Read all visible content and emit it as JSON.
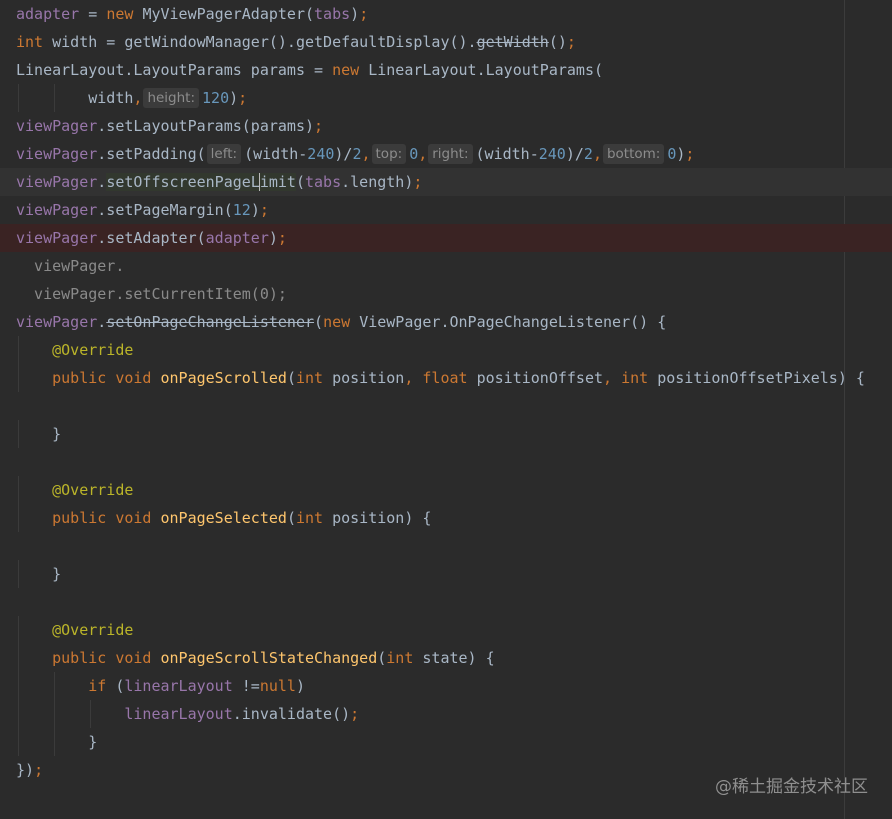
{
  "editor": {
    "language": "java",
    "lines": [
      [
        [
          "var",
          "adapter"
        ],
        [
          "txt",
          " = "
        ],
        [
          "kw",
          "new "
        ],
        [
          "txt",
          "MyViewPagerAdapter("
        ],
        [
          "var",
          "tabs"
        ],
        [
          "txt",
          ")"
        ],
        [
          "kw",
          ";"
        ]
      ],
      [
        [
          "kw",
          "int "
        ],
        [
          "txt",
          "width = getWindowManager().getDefaultDisplay()."
        ],
        [
          "strike",
          "getWidth"
        ],
        [
          "txt",
          "()"
        ],
        [
          "kw",
          ";"
        ]
      ],
      [
        [
          "txt",
          "LinearLayout.LayoutParams params = "
        ],
        [
          "kw",
          "new "
        ],
        [
          "txt",
          "LinearLayout.LayoutParams("
        ]
      ],
      [
        [
          "txt",
          "        width"
        ],
        [
          "kw",
          ","
        ],
        [
          "hint",
          "height:"
        ],
        [
          "num",
          "120"
        ],
        [
          "txt",
          ")"
        ],
        [
          "kw",
          ";"
        ]
      ],
      [
        [
          "var",
          "viewPager"
        ],
        [
          "txt",
          ".setLayoutParams(params)"
        ],
        [
          "kw",
          ";"
        ]
      ],
      [
        [
          "var",
          "viewPager"
        ],
        [
          "txt",
          ".setPadding("
        ],
        [
          "hint",
          "left:"
        ],
        [
          "txt",
          "(width-"
        ],
        [
          "num",
          "240"
        ],
        [
          "txt",
          ")/"
        ],
        [
          "num",
          "2"
        ],
        [
          "kw",
          ","
        ],
        [
          "hint",
          "top:"
        ],
        [
          "num",
          "0"
        ],
        [
          "kw",
          ","
        ],
        [
          "hint",
          "right:"
        ],
        [
          "txt",
          "(width-"
        ],
        [
          "num",
          "240"
        ],
        [
          "txt",
          ")/"
        ],
        [
          "num",
          "2"
        ],
        [
          "kw",
          ","
        ],
        [
          "hint",
          "bottom:"
        ],
        [
          "num",
          "0"
        ],
        [
          "txt",
          ")"
        ],
        [
          "kw",
          ";"
        ]
      ],
      [
        [
          "var",
          "viewPager"
        ],
        [
          "txt",
          "."
        ],
        [
          "hl",
          "setOffscreenPageL"
        ],
        [
          "caret",
          ""
        ],
        [
          "hl",
          "imit"
        ],
        [
          "txt",
          "("
        ],
        [
          "var",
          "tabs"
        ],
        [
          "txt",
          ".length)"
        ],
        [
          "kw",
          ";"
        ]
      ],
      [
        [
          "var",
          "viewPager"
        ],
        [
          "txt",
          ".setPageMargin("
        ],
        [
          "num",
          "12"
        ],
        [
          "txt",
          ")"
        ],
        [
          "kw",
          ";"
        ]
      ],
      [
        [
          "var",
          "viewPager"
        ],
        [
          "txt",
          ".setAdapter("
        ],
        [
          "var",
          "adapter"
        ],
        [
          "txt",
          ")"
        ],
        [
          "kw",
          ";"
        ]
      ],
      [
        [
          "dim",
          "  viewPager."
        ]
      ],
      [
        [
          "dim",
          "  viewPager.setCurrentItem(0);"
        ]
      ],
      [
        [
          "var",
          "viewPager"
        ],
        [
          "txt",
          "."
        ],
        [
          "strike",
          "setOnPageChangeListener"
        ],
        [
          "txt",
          "("
        ],
        [
          "kw",
          "new "
        ],
        [
          "txt",
          "ViewPager.OnPageChangeListener() {"
        ]
      ],
      [
        [
          "txt",
          "    "
        ],
        [
          "ann",
          "@Override"
        ]
      ],
      [
        [
          "txt",
          "    "
        ],
        [
          "kw",
          "public void "
        ],
        [
          "fn",
          "onPageScrolled"
        ],
        [
          "txt",
          "("
        ],
        [
          "kw",
          "int "
        ],
        [
          "txt",
          "position"
        ],
        [
          "kw",
          ", float "
        ],
        [
          "txt",
          "positionOffset"
        ],
        [
          "kw",
          ", int "
        ],
        [
          "txt",
          "positionOffsetPixels) {"
        ]
      ],
      [
        [
          "txt",
          ""
        ]
      ],
      [
        [
          "txt",
          "    }"
        ]
      ],
      [
        [
          "txt",
          ""
        ]
      ],
      [
        [
          "txt",
          "    "
        ],
        [
          "ann",
          "@Override"
        ]
      ],
      [
        [
          "txt",
          "    "
        ],
        [
          "kw",
          "public void "
        ],
        [
          "fn",
          "onPageSelected"
        ],
        [
          "txt",
          "("
        ],
        [
          "kw",
          "int "
        ],
        [
          "txt",
          "position) {"
        ]
      ],
      [
        [
          "txt",
          ""
        ]
      ],
      [
        [
          "txt",
          "    }"
        ]
      ],
      [
        [
          "txt",
          ""
        ]
      ],
      [
        [
          "txt",
          "    "
        ],
        [
          "ann",
          "@Override"
        ]
      ],
      [
        [
          "txt",
          "    "
        ],
        [
          "kw",
          "public void "
        ],
        [
          "fn",
          "onPageScrollStateChanged"
        ],
        [
          "txt",
          "("
        ],
        [
          "kw",
          "int "
        ],
        [
          "txt",
          "state) {"
        ]
      ],
      [
        [
          "txt",
          "        "
        ],
        [
          "kw",
          "if "
        ],
        [
          "txt",
          "("
        ],
        [
          "var",
          "linearLayout "
        ],
        [
          "txt",
          "!="
        ],
        [
          "kw",
          "null"
        ],
        [
          "txt",
          ")"
        ]
      ],
      [
        [
          "txt",
          "            "
        ],
        [
          "var",
          "linearLayout"
        ],
        [
          "txt",
          ".invalidate()"
        ],
        [
          "kw",
          ";"
        ]
      ],
      [
        [
          "txt",
          "        }"
        ]
      ],
      [
        [
          "txt",
          "})"
        ],
        [
          "kw",
          ";"
        ]
      ]
    ],
    "current_line_index": 6,
    "breakpoint_line_index": 8
  },
  "watermark": "@稀土掘金技术社区",
  "colors": {
    "background": "#2b2b2b",
    "keyword": "#cc7832",
    "field": "#9876aa",
    "number": "#6897bb",
    "method_decl": "#ffc66d",
    "annotation": "#bbb529",
    "default_text": "#a9b7c6"
  }
}
